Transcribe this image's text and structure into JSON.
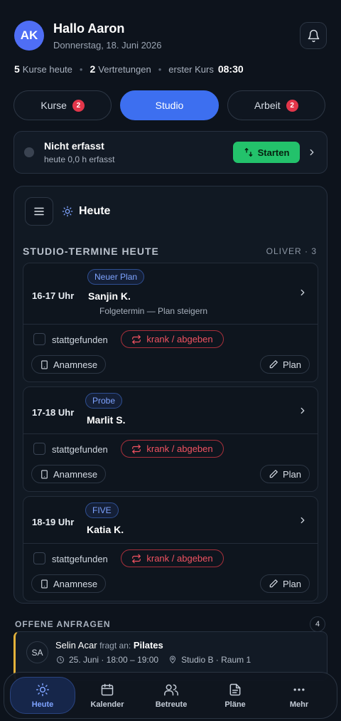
{
  "header": {
    "avatar_initials": "AK",
    "greeting": "Hallo Aaron",
    "date": "Donnerstag, 18. Juni 2026"
  },
  "stats": {
    "courses_count": "5",
    "courses_label": "Kurse heute",
    "subs_count": "2",
    "subs_label": "Vertretungen",
    "first_label": "erster Kurs",
    "first_time": "08:30"
  },
  "tabs": [
    {
      "label": "Kurse",
      "badge": "2",
      "active": false
    },
    {
      "label": "Studio",
      "badge": "",
      "active": true
    },
    {
      "label": "Arbeit",
      "badge": "2",
      "active": false
    }
  ],
  "tracker": {
    "status": "Nicht erfasst",
    "sub": "heute 0,0 h erfasst",
    "start_label": "Starten"
  },
  "panel": {
    "title": "Heute",
    "section_title": "STUDIO-TERMINE HEUTE",
    "section_right": "OLIVER · 3"
  },
  "appointments": [
    {
      "time": "16-17 Uhr",
      "tag": "Neuer Plan",
      "name": "Sanjin K.",
      "note": "Folgetermin — Plan steigern",
      "check_label": "stattgefunden",
      "sick_label": "krank / abgeben",
      "anamnese_label": "Anamnese",
      "plan_label": "Plan"
    },
    {
      "time": "17-18 Uhr",
      "tag": "Probe",
      "name": "Marlit S.",
      "note": "",
      "check_label": "stattgefunden",
      "sick_label": "krank / abgeben",
      "anamnese_label": "Anamnese",
      "plan_label": "Plan"
    },
    {
      "time": "18-19 Uhr",
      "tag": "FIVE",
      "name": "Katia K.",
      "note": "",
      "check_label": "stattgefunden",
      "sick_label": "krank / abgeben",
      "anamnese_label": "Anamnese",
      "plan_label": "Plan"
    }
  ],
  "requests": {
    "title": "OFFENE ANFRAGEN",
    "count": "4",
    "items": [
      {
        "initials": "SA",
        "name": "Selin Acar",
        "asks": "fragt an:",
        "course": "Pilates",
        "when": "25. Juni · 18:00 – 19:00",
        "where": "Studio B · Raum 1"
      }
    ]
  },
  "nav": [
    {
      "label": "Heute",
      "icon": "sun-icon",
      "active": true
    },
    {
      "label": "Kalender",
      "icon": "calendar-icon",
      "active": false
    },
    {
      "label": "Betreute",
      "icon": "users-icon",
      "active": false
    },
    {
      "label": "Pläne",
      "icon": "document-icon",
      "active": false
    },
    {
      "label": "Mehr",
      "icon": "more-icon",
      "active": false
    }
  ],
  "colors": {
    "accent": "#3d6ff0",
    "success": "#23c26b",
    "danger": "#e2364a",
    "warning": "#e4b23a",
    "background": "#0d131c"
  }
}
